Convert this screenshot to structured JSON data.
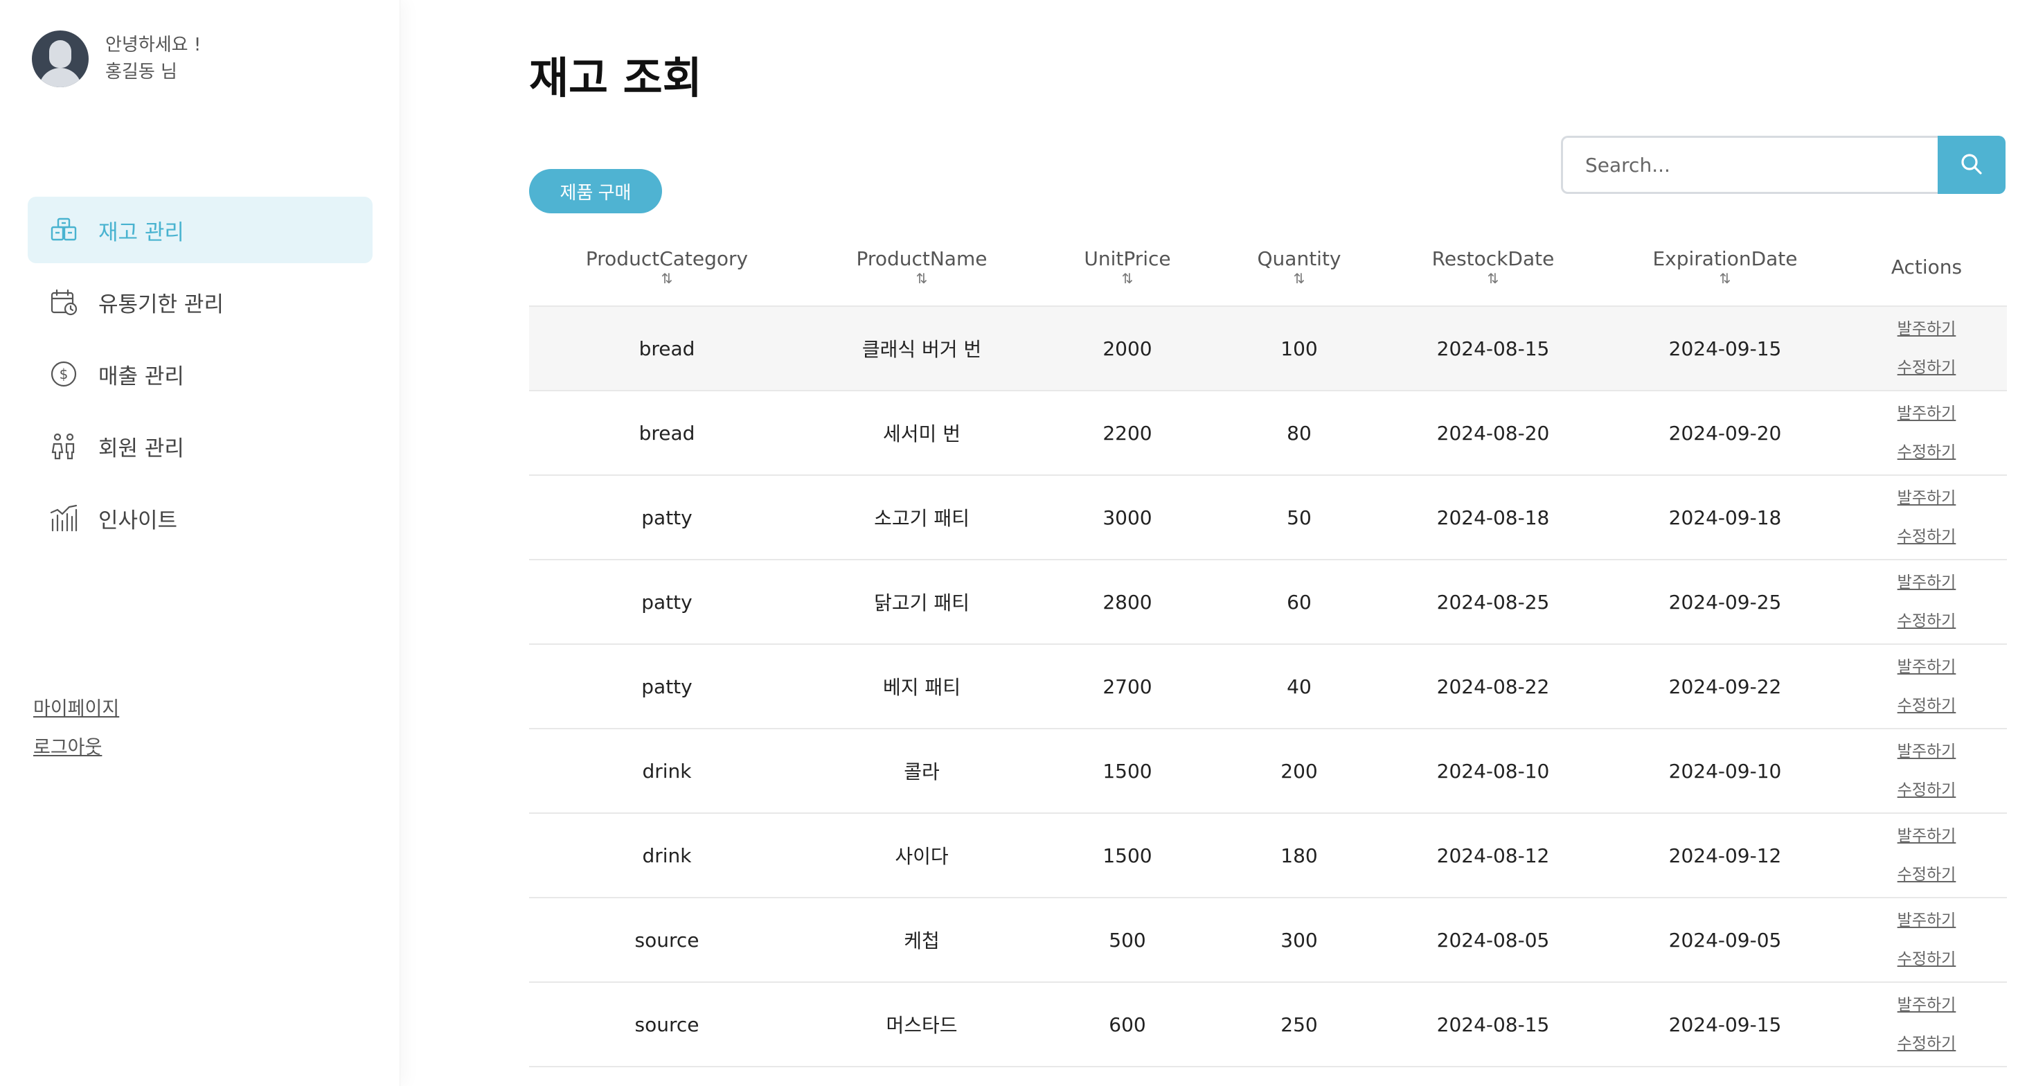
{
  "user": {
    "greeting": "안녕하세요 !",
    "name": "홍길동 님"
  },
  "sidebar": {
    "items": [
      {
        "label": "재고 관리",
        "icon": "inventory-icon",
        "active": true
      },
      {
        "label": "유통기한 관리",
        "icon": "calendar-clock-icon",
        "active": false
      },
      {
        "label": "매출 관리",
        "icon": "dollar-icon",
        "active": false
      },
      {
        "label": "회원 관리",
        "icon": "members-icon",
        "active": false
      },
      {
        "label": "인사이트",
        "icon": "insight-chart-icon",
        "active": false
      }
    ],
    "mypage": "마이페이지",
    "logout": "로그아웃"
  },
  "page": {
    "title": "재고 조회",
    "buy_button": "제품 구매",
    "search_placeholder": "Search..."
  },
  "table": {
    "headers": [
      "ProductCategory",
      "ProductName",
      "UnitPrice",
      "Quantity",
      "RestockDate",
      "ExpirationDate",
      "Actions"
    ],
    "sort_symbol": "⇅",
    "action_order": "발주하기",
    "action_edit": "수정하기",
    "rows": [
      [
        "bread",
        "클래식 버거 번",
        "2000",
        "100",
        "2024-08-15",
        "2024-09-15"
      ],
      [
        "bread",
        "세서미 번",
        "2200",
        "80",
        "2024-08-20",
        "2024-09-20"
      ],
      [
        "patty",
        "소고기 패티",
        "3000",
        "50",
        "2024-08-18",
        "2024-09-18"
      ],
      [
        "patty",
        "닭고기 패티",
        "2800",
        "60",
        "2024-08-25",
        "2024-09-25"
      ],
      [
        "patty",
        "베지 패티",
        "2700",
        "40",
        "2024-08-22",
        "2024-09-22"
      ],
      [
        "drink",
        "콜라",
        "1500",
        "200",
        "2024-08-10",
        "2024-09-10"
      ],
      [
        "drink",
        "사이다",
        "1500",
        "180",
        "2024-08-12",
        "2024-09-12"
      ],
      [
        "source",
        "케첩",
        "500",
        "300",
        "2024-08-05",
        "2024-09-05"
      ],
      [
        "source",
        "머스타드",
        "600",
        "250",
        "2024-08-15",
        "2024-09-15"
      ]
    ]
  },
  "colors": {
    "accent": "#4fb3d2",
    "active_nav_bg": "#e5f4f9"
  }
}
